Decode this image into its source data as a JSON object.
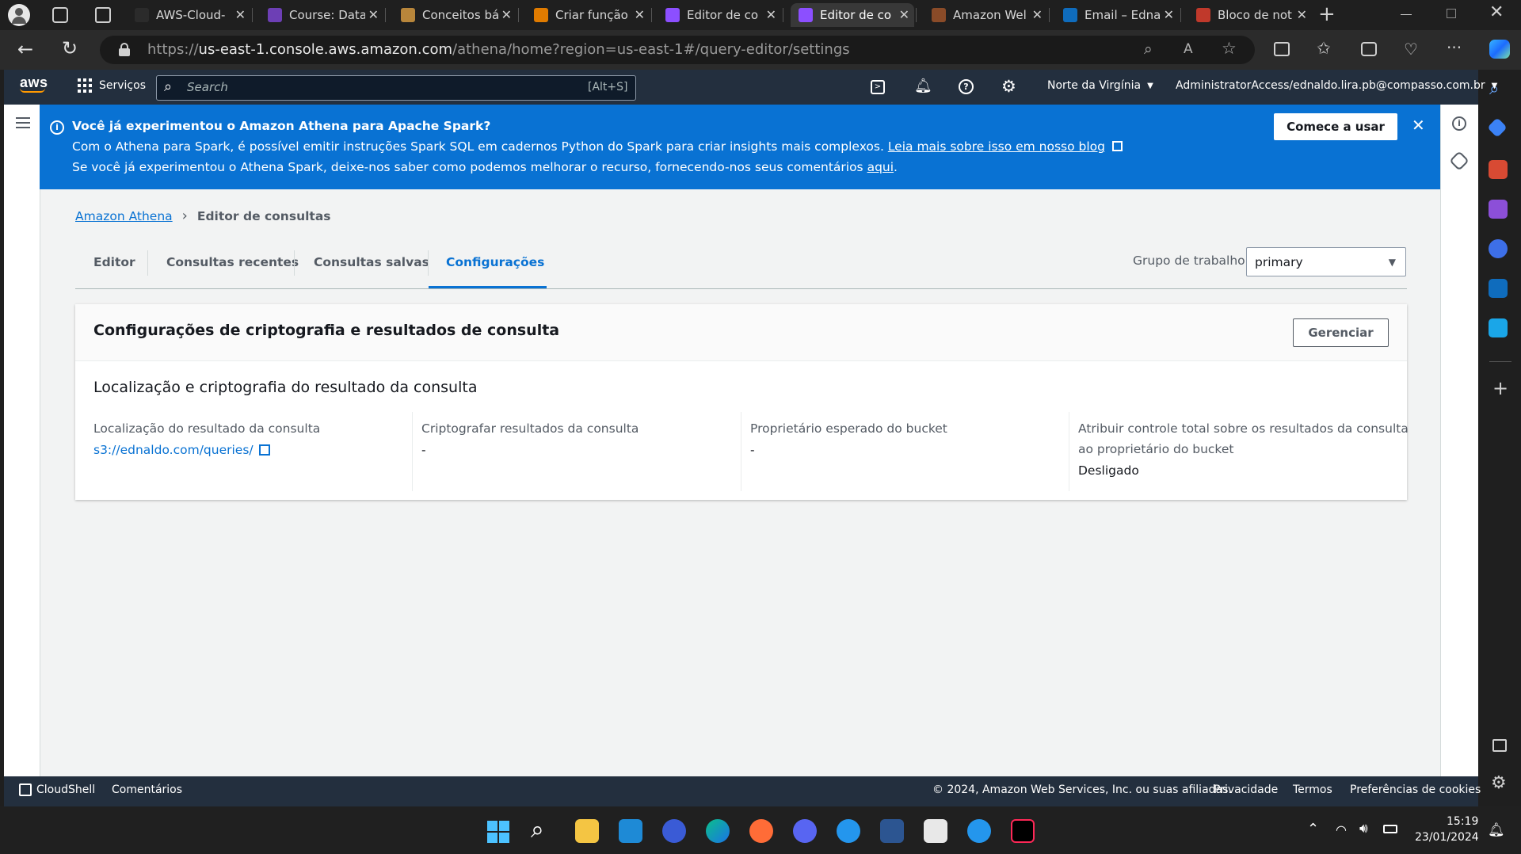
{
  "browser": {
    "tabs": [
      {
        "title": "AWS-Cloud-",
        "favicon": "github-icon",
        "color": "#2b2b2b"
      },
      {
        "title": "Course: Data",
        "favicon": "course-icon",
        "color": "#6d3fb5"
      },
      {
        "title": "Conceitos bá",
        "favicon": "box-icon",
        "color": "#b8863b"
      },
      {
        "title": "Criar função",
        "favicon": "lambda-icon",
        "color": "#e07b00"
      },
      {
        "title": "Editor de co",
        "favicon": "athena-icon",
        "color": "#8c4fff"
      },
      {
        "title": "Editor de co",
        "favicon": "athena-icon",
        "color": "#8c4fff"
      },
      {
        "title": "Amazon Wel",
        "favicon": "aws-box-icon",
        "color": "#8a4b28"
      },
      {
        "title": "Email – Edna",
        "favicon": "outlook-icon",
        "color": "#0f6cbd"
      },
      {
        "title": "Bloco de not",
        "favicon": "notepad-icon",
        "color": "#c0392b"
      }
    ],
    "url_scheme": "https://",
    "url_host": "us-east-1.console.aws.amazon.com",
    "url_path": "/athena/home?region=us-east-1#/query-editor/settings"
  },
  "awsnav": {
    "logo": "aws",
    "services": "Serviços",
    "search_placeholder": "Search",
    "search_shortcut": "[Alt+S]",
    "region": "Norte da Virgínia",
    "account": "AdministratorAccess/ednaldo.lira.pb@compasso.com.br"
  },
  "banner": {
    "title": "Você já experimentou o Amazon Athena para Apache Spark?",
    "line1": "Com o Athena para Spark, é possível emitir instruções Spark SQL em cadernos Python do Spark para criar insights mais complexos.",
    "line1_link": "Leia mais sobre isso em nosso blog",
    "line2": "Se você já experimentou o Athena Spark, deixe-nos saber como podemos melhorar o recurso, fornecendo-nos seus comentários",
    "line2_link": "aqui",
    "line2_end": ".",
    "cta": "Comece a usar"
  },
  "breadcrumb": {
    "root": "Amazon Athena",
    "current": "Editor de consultas"
  },
  "tabs": [
    {
      "label": "Editor"
    },
    {
      "label": "Consultas recentes"
    },
    {
      "label": "Consultas salvas"
    },
    {
      "label": "Configurações"
    }
  ],
  "workgroup": {
    "label": "Grupo de trabalho",
    "value": "primary"
  },
  "panel": {
    "title": "Configurações de criptografia e resultados de consulta",
    "manage": "Gerenciar",
    "section": "Localização e criptografia do resultado da consulta",
    "fields": [
      {
        "label": "Localização do resultado da consulta",
        "value": "s3://ednaldo.com/queries/"
      },
      {
        "label": "Criptografar resultados da consulta",
        "value": "-"
      },
      {
        "label": "Proprietário esperado do bucket",
        "value": "-"
      },
      {
        "label_line1": "Atribuir controle total sobre os resultados da consulta",
        "label_line2": "ao proprietário do bucket",
        "value": "Desligado"
      }
    ]
  },
  "footer": {
    "cloudshell": "CloudShell",
    "comments": "Comentários",
    "copyright": "© 2024, Amazon Web Services, Inc. ou suas afiliadas.",
    "privacy": "Privacidade",
    "terms": "Termos",
    "cookies": "Preferências de cookies"
  },
  "taskbar": {
    "time": "15:19",
    "date": "23/01/2024"
  },
  "colors": {
    "aws_nav": "#232f3e",
    "banner": "#0972d3",
    "link": "#0972d3",
    "aws_orange": "#ff9900"
  }
}
